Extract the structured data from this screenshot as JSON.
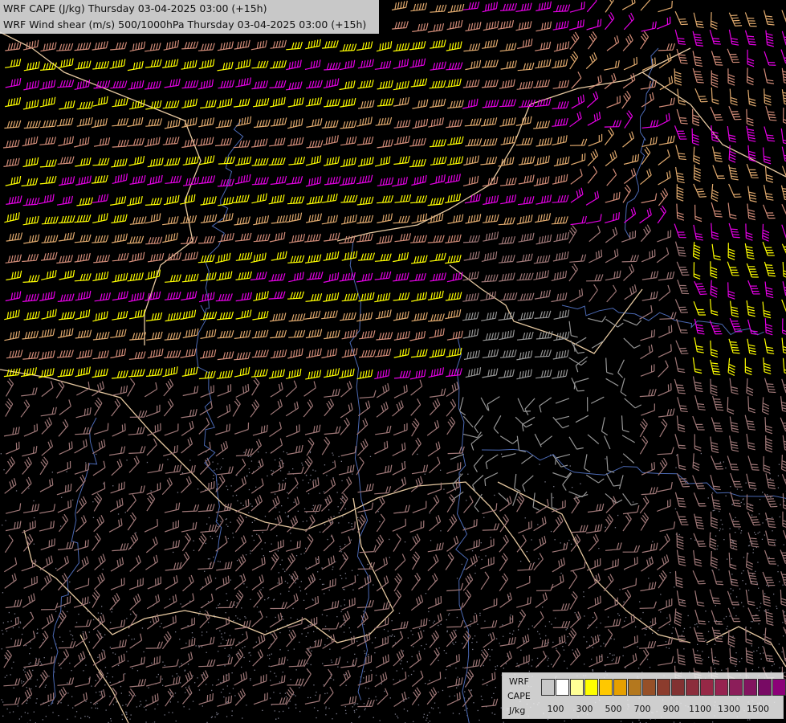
{
  "title": {
    "line1": "WRF CAPE (J/kg) Thursday 03-04-2025 03:00 (+15h)",
    "line2": "WRF Wind shear (m/s) 500/1000hPa Thursday 03-04-2025 03:00 (+15h)"
  },
  "legend": {
    "label_lines": [
      "WRF",
      "CAPE",
      "J/kg"
    ],
    "colors": [
      "#c8c8c8",
      "#ffffff",
      "#ffff96",
      "#ffff00",
      "#ffc800",
      "#e6a000",
      "#b4781e",
      "#965028",
      "#8c3c2d",
      "#823232",
      "#8c2d3c",
      "#962846",
      "#962350",
      "#8c1e5a",
      "#82145f",
      "#780a64",
      "#8c0078",
      "#a0008c"
    ],
    "ticks": [
      "100",
      "300",
      "500",
      "700",
      "900",
      "1100",
      "1300",
      "1500"
    ]
  },
  "colors": {
    "background": "#000000",
    "barb_low": "#a07878",
    "barb_mid": "#d28c78",
    "barb_yellow": "#ffff00",
    "barb_tan": "#e1aa6e",
    "barb_magenta": "#e600e6",
    "barb_grey": "#969696",
    "border": "#e6c8a0",
    "river": "#4b69b4"
  }
}
